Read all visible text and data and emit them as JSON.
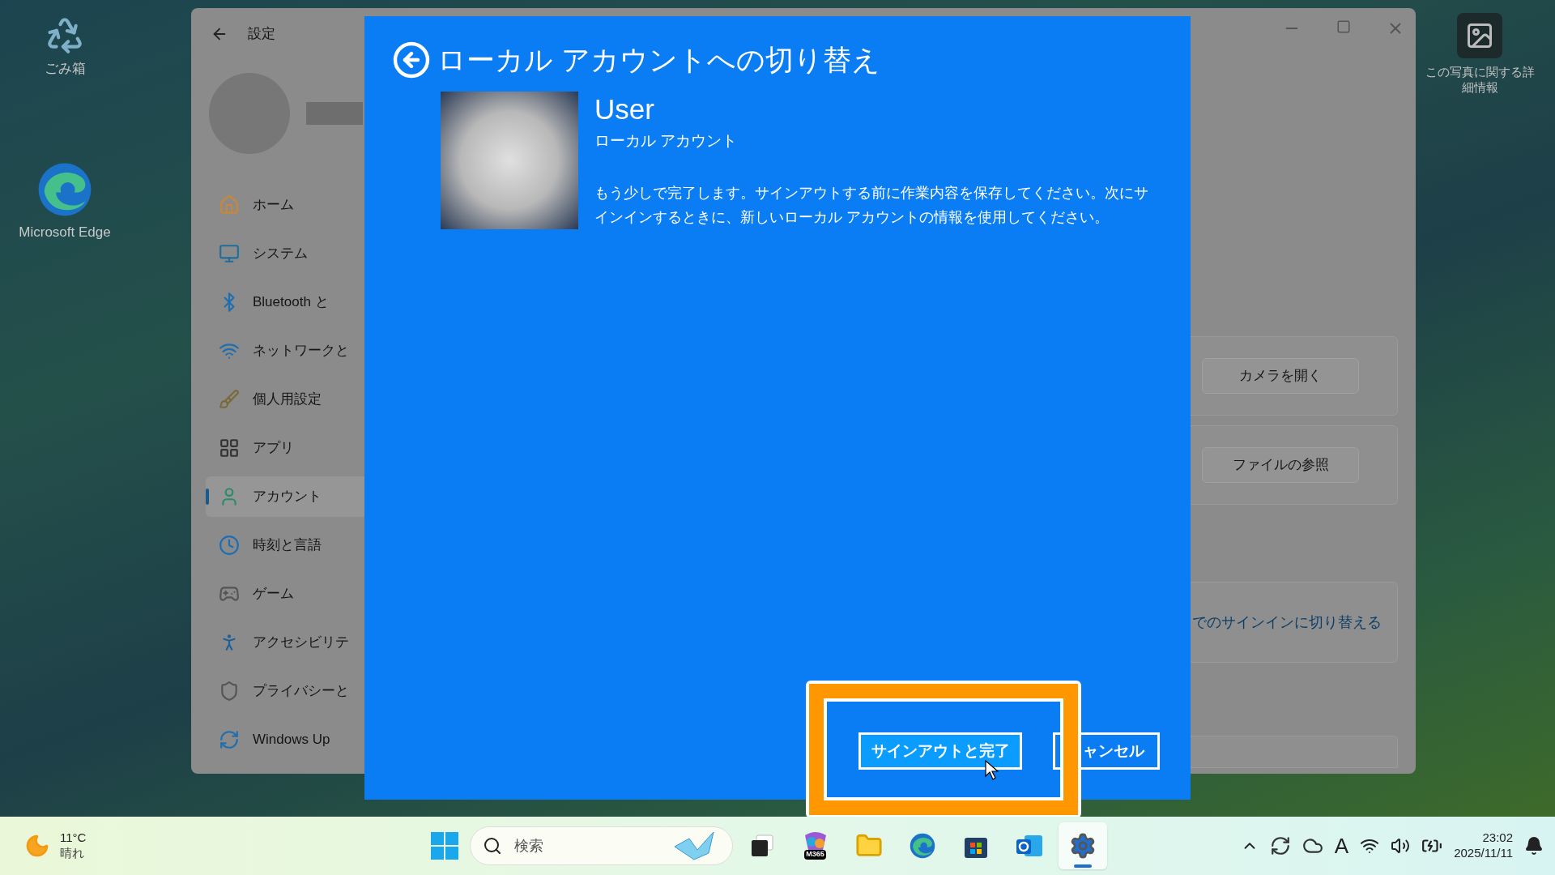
{
  "desktop": {
    "icons": [
      {
        "kind": "recycle",
        "label": "ごみ箱"
      },
      {
        "kind": "edge",
        "label": "Microsoft Edge"
      }
    ],
    "photo_info": {
      "label": "この写真に関する詳細情報"
    }
  },
  "settings_window": {
    "title": "設定",
    "nav": [
      {
        "kind": "home",
        "label": "ホーム",
        "selected": false
      },
      {
        "kind": "system",
        "label": "システム",
        "selected": false
      },
      {
        "kind": "bluetooth",
        "label": "Bluetooth と",
        "selected": false
      },
      {
        "kind": "network",
        "label": "ネットワークと",
        "selected": false
      },
      {
        "kind": "personalize",
        "label": "個人用設定",
        "selected": false
      },
      {
        "kind": "apps",
        "label": "アプリ",
        "selected": false
      },
      {
        "kind": "accounts",
        "label": "アカウント",
        "selected": true
      },
      {
        "kind": "time",
        "label": "時刻と言語",
        "selected": false
      },
      {
        "kind": "gaming",
        "label": "ゲーム",
        "selected": false
      },
      {
        "kind": "accessibility",
        "label": "アクセシビリテ",
        "selected": false
      },
      {
        "kind": "privacy",
        "label": "プライバシーと",
        "selected": false
      },
      {
        "kind": "update",
        "label": "Windows Up",
        "selected": false
      }
    ],
    "buttons": [
      "カメラを開く",
      "ファイルの参照"
    ],
    "link": "でのサインインに切り替える"
  },
  "dialog": {
    "title": "ローカル アカウントへの切り替え",
    "user_name": "User",
    "account_type": "ローカル アカウント",
    "message": "もう少しで完了します。サインアウトする前に作業内容を保存してください。次にサインインするときに、新しいローカル アカウントの情報を使用してください。",
    "buttons": [
      {
        "label": "サインアウトと完了",
        "kind": "primary"
      },
      {
        "label": "ャンセル",
        "kind": "secondary"
      }
    ]
  },
  "taskbar": {
    "weather": {
      "temperature": "11°C",
      "condition": "晴れ"
    },
    "search": {
      "placeholder": "検索"
    },
    "apps": [
      {
        "kind": "taskview",
        "active": false
      },
      {
        "kind": "copilot",
        "label": "M365",
        "active": false
      },
      {
        "kind": "explorer",
        "active": false
      },
      {
        "kind": "edge",
        "active": false
      },
      {
        "kind": "store",
        "active": false
      },
      {
        "kind": "outlook",
        "active": false
      },
      {
        "kind": "settings",
        "active": true
      }
    ],
    "ime": "A",
    "time": "23:02",
    "date": "2025/11/11"
  }
}
